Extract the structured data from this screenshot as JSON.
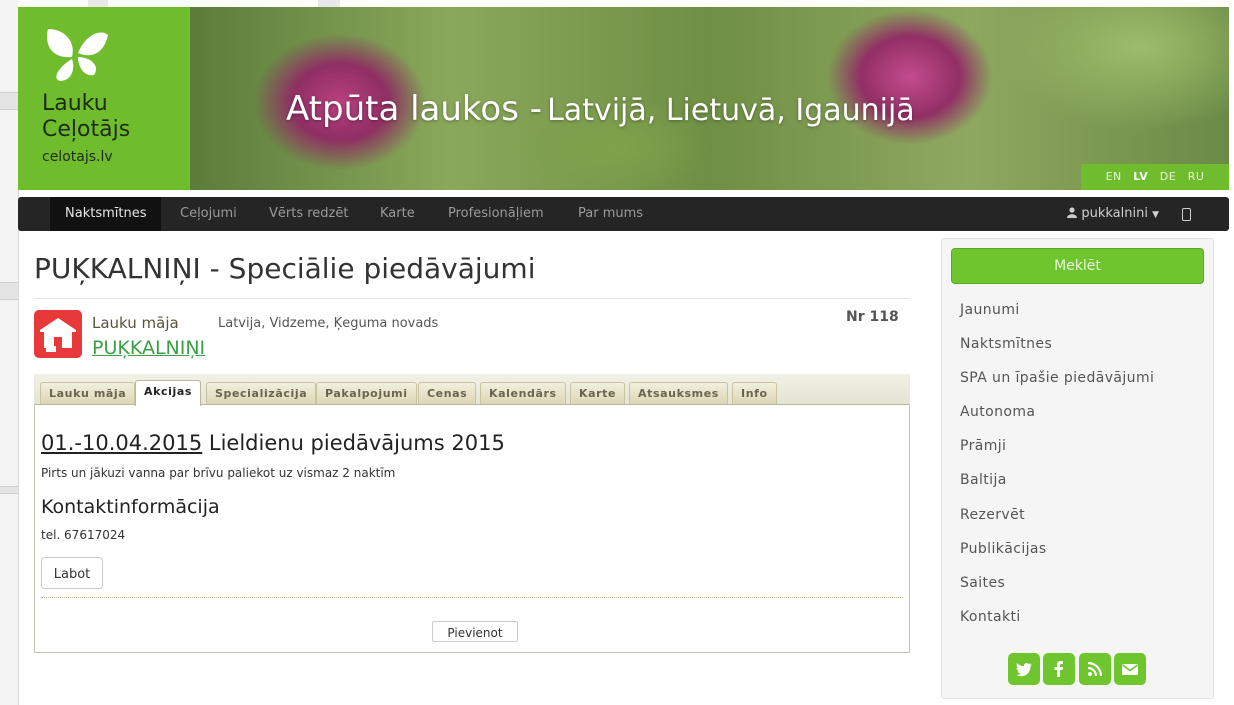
{
  "header": {
    "logo_line1": "Lauku",
    "logo_line2": "Ceļotājs",
    "logo_line3": "celotajs.lv",
    "banner_title_main": "Atpūta laukos -",
    "banner_title_sub": "Latvijā, Lietuvā, Igaunijā",
    "languages": [
      "EN",
      "LV",
      "DE",
      "RU"
    ],
    "active_language": "LV"
  },
  "nav": {
    "items": [
      "Naktsmītnes",
      "Ceļojumi",
      "Vērts redzēt",
      "Karte",
      "Profesionāļiem",
      "Par mums"
    ],
    "active": "Naktsmītnes",
    "user": "pukkalnini"
  },
  "page": {
    "title": "PUĶKALNIŅI - Speciālie piedāvājumi",
    "type_label": "Lauku māja",
    "location": "Latvija, Vidzeme, Ķeguma novads",
    "number": "Nr 118",
    "place_name": "PUĶKALNIŅI"
  },
  "tabs": [
    "Lauku māja",
    "Akcijas",
    "Specializācija",
    "Pakalpojumi",
    "Cenas",
    "Kalendārs",
    "Karte",
    "Atsauksmes",
    "Info"
  ],
  "active_tab": "Akcijas",
  "offer": {
    "date": "01.-10.04.2015",
    "title": " Lieldienu piedāvājums 2015",
    "description": "Pirts un jākuzi vanna par brīvu paliekot uz vismaz 2 naktīm",
    "contact_heading": "Kontaktinformācija",
    "phone": "tel. 67617024",
    "edit_label": "Labot",
    "add_label": "Pievienot"
  },
  "sidebar": {
    "search_label": "Meklēt",
    "links": [
      "Jaunumi",
      "Naktsmītnes",
      "SPA un īpašie piedāvājumi",
      "Autonoma",
      "Prāmji",
      "Baltija",
      "Rezervēt",
      "Publikācijas",
      "Saites",
      "Kontakti"
    ],
    "social_icons": [
      "twitter-icon",
      "facebook-icon",
      "rss-icon",
      "email-icon"
    ]
  },
  "colors": {
    "brand_green": "#6fbd2c",
    "link_green": "#3aa047",
    "nav_dark": "#252525",
    "house_red": "#e8393a"
  }
}
